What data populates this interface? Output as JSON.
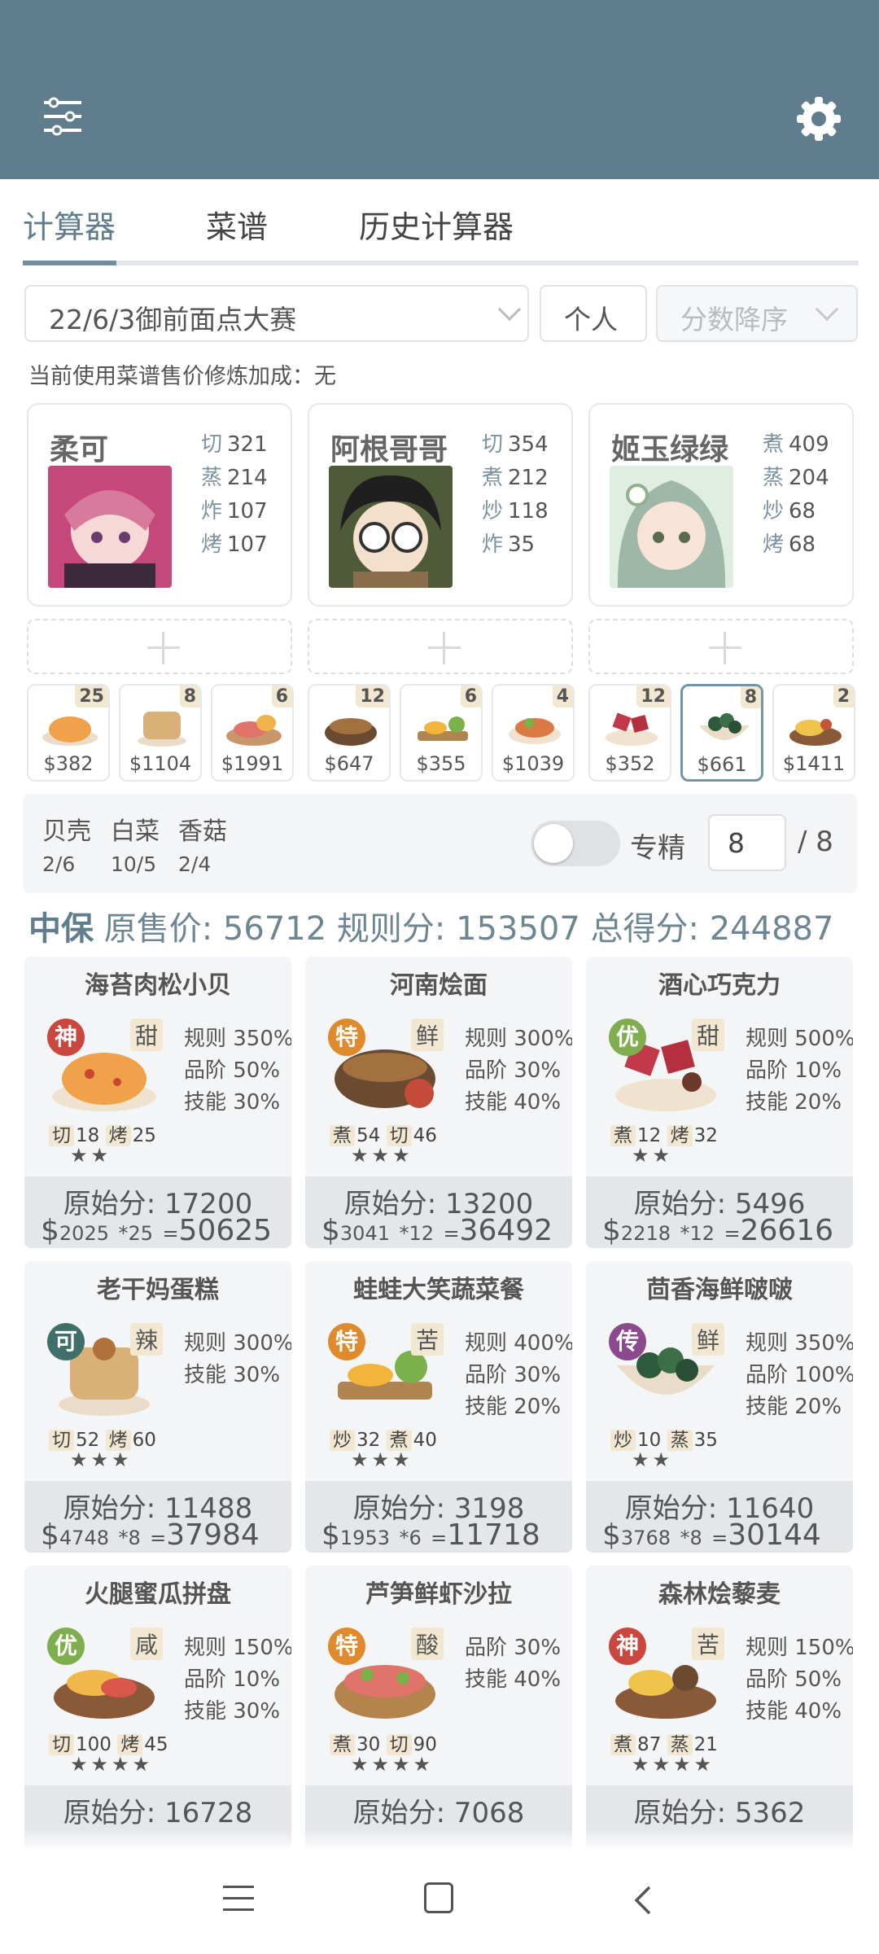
{
  "colors": {
    "header": "#5f7d8c",
    "accent": "#6f8d9b",
    "panel": "#f3f5f7"
  },
  "header": {
    "left_icon": "sliders-icon",
    "right_icon": "gear-icon"
  },
  "tabs": [
    {
      "label": "计算器"
    },
    {
      "label": "菜谱"
    },
    {
      "label": "历史计算器"
    }
  ],
  "controls": {
    "event": "22/6/3御前面点大赛",
    "mode": "个人",
    "sort": "分数降序"
  },
  "note": "当前使用菜谱售价修炼加成：无",
  "chefs": [
    {
      "name": "柔可",
      "stats": [
        {
          "k": "切",
          "v": "321"
        },
        {
          "k": "蒸",
          "v": "214"
        },
        {
          "k": "炸",
          "v": "107"
        },
        {
          "k": "烤",
          "v": "107"
        }
      ]
    },
    {
      "name": "阿根哥哥",
      "stats": [
        {
          "k": "切",
          "v": "354"
        },
        {
          "k": "煮",
          "v": "212"
        },
        {
          "k": "炒",
          "v": "118"
        },
        {
          "k": "炸",
          "v": "35"
        }
      ]
    },
    {
      "name": "姬玉绿绿",
      "stats": [
        {
          "k": "煮",
          "v": "409"
        },
        {
          "k": "蒸",
          "v": "204"
        },
        {
          "k": "炒",
          "v": "68"
        },
        {
          "k": "烤",
          "v": "68"
        }
      ]
    }
  ],
  "dishes": [
    {
      "count": "25",
      "price": "$382"
    },
    {
      "count": "8",
      "price": "$1104"
    },
    {
      "count": "6",
      "price": "$1991"
    },
    {
      "count": "12",
      "price": "$647"
    },
    {
      "count": "6",
      "price": "$355"
    },
    {
      "count": "4",
      "price": "$1039"
    },
    {
      "count": "12",
      "price": "$352"
    },
    {
      "count": "8",
      "price": "$661"
    },
    {
      "count": "2",
      "price": "$1411"
    }
  ],
  "ingredients": [
    {
      "name": "贝壳",
      "count": "2/6"
    },
    {
      "name": "白菜",
      "count": "10/5"
    },
    {
      "name": "香菇",
      "count": "2/4"
    }
  ],
  "specialize": {
    "label": "专精",
    "value": "8",
    "max": "/ 8"
  },
  "summary": {
    "grade": "中保",
    "price_label": "原售价:",
    "price": "56712",
    "rule_label": "规则分:",
    "rule": "153507",
    "total_label": "总得分:",
    "total": "244887"
  },
  "recipes": [
    {
      "name": "海苔肉松小贝",
      "rarity": "神",
      "flavor": "甜",
      "s1": "切",
      "v1": "18",
      "s2": "烤",
      "v2": "25",
      "stars": "★★",
      "rules": [
        "规则 350%",
        "品阶 50%",
        "技能 30%"
      ],
      "orig": "原始分: 17200",
      "price": "$",
      "unit": "2025",
      "mult": "*25",
      "eq": "=",
      "score": "50625"
    },
    {
      "name": "河南烩面",
      "rarity": "特",
      "flavor": "鲜",
      "s1": "煮",
      "v1": "54",
      "s2": "切",
      "v2": "46",
      "stars": "★★★",
      "rules": [
        "规则 300%",
        "品阶 30%",
        "技能 40%"
      ],
      "orig": "原始分: 13200",
      "price": "$",
      "unit": "3041",
      "mult": "*12",
      "eq": "=",
      "score": "36492"
    },
    {
      "name": "酒心巧克力",
      "rarity": "优",
      "flavor": "甜",
      "s1": "煮",
      "v1": "12",
      "s2": "烤",
      "v2": "32",
      "stars": "★★",
      "rules": [
        "规则 500%",
        "品阶 10%",
        "技能 20%"
      ],
      "orig": "原始分: 5496",
      "price": "$",
      "unit": "2218",
      "mult": "*12",
      "eq": "=",
      "score": "26616"
    },
    {
      "name": "老干妈蛋糕",
      "rarity": "可",
      "flavor": "辣",
      "s1": "切",
      "v1": "52",
      "s2": "烤",
      "v2": "60",
      "stars": "★★★",
      "rules": [
        "规则 300%",
        "技能 30%",
        ""
      ],
      "orig": "原始分: 11488",
      "price": "$",
      "unit": "4748",
      "mult": "*8",
      "eq": "=",
      "score": "37984"
    },
    {
      "name": "蛙蛙大笑蔬菜餐",
      "rarity": "特",
      "flavor": "苦",
      "s1": "炒",
      "v1": "32",
      "s2": "煮",
      "v2": "40",
      "stars": "★★★",
      "rules": [
        "规则 400%",
        "品阶 30%",
        "技能 20%"
      ],
      "orig": "原始分: 3198",
      "price": "$",
      "unit": "1953",
      "mult": "*6",
      "eq": "=",
      "score": "11718"
    },
    {
      "name": "茴香海鲜啵啵",
      "rarity": "传",
      "flavor": "鲜",
      "s1": "炒",
      "v1": "10",
      "s2": "蒸",
      "v2": "35",
      "stars": "★★",
      "rules": [
        "规则 350%",
        "品阶 100%",
        "技能 20%"
      ],
      "orig": "原始分: 11640",
      "price": "$",
      "unit": "3768",
      "mult": "*8",
      "eq": "=",
      "score": "30144"
    },
    {
      "name": "火腿蜜瓜拼盘",
      "rarity": "优",
      "flavor": "咸",
      "s1": "切",
      "v1": "100",
      "s2": "烤",
      "v2": "45",
      "stars": "★★★★",
      "rules": [
        "规则 150%",
        "品阶 10%",
        "技能 30%"
      ],
      "orig": "原始分: 16728",
      "price": "",
      "unit": "",
      "mult": "",
      "eq": "",
      "score": ""
    },
    {
      "name": "芦笋鲜虾沙拉",
      "rarity": "特",
      "flavor": "酸",
      "s1": "煮",
      "v1": "30",
      "s2": "切",
      "v2": "90",
      "stars": "★★★★",
      "rules": [
        "品阶 30%",
        "技能 40%",
        ""
      ],
      "orig": "原始分: 7068",
      "price": "",
      "unit": "",
      "mult": "",
      "eq": "",
      "score": ""
    },
    {
      "name": "森林烩藜麦",
      "rarity": "神",
      "flavor": "苦",
      "s1": "煮",
      "v1": "87",
      "s2": "蒸",
      "v2": "21",
      "stars": "★★★★",
      "rules": [
        "规则 150%",
        "品阶 50%",
        "技能 40%"
      ],
      "orig": "原始分: 5362",
      "price": "",
      "unit": "",
      "mult": "",
      "eq": "",
      "score": ""
    }
  ],
  "navbar": {
    "icons": [
      "menu-icon",
      "home-icon",
      "back-icon"
    ]
  }
}
